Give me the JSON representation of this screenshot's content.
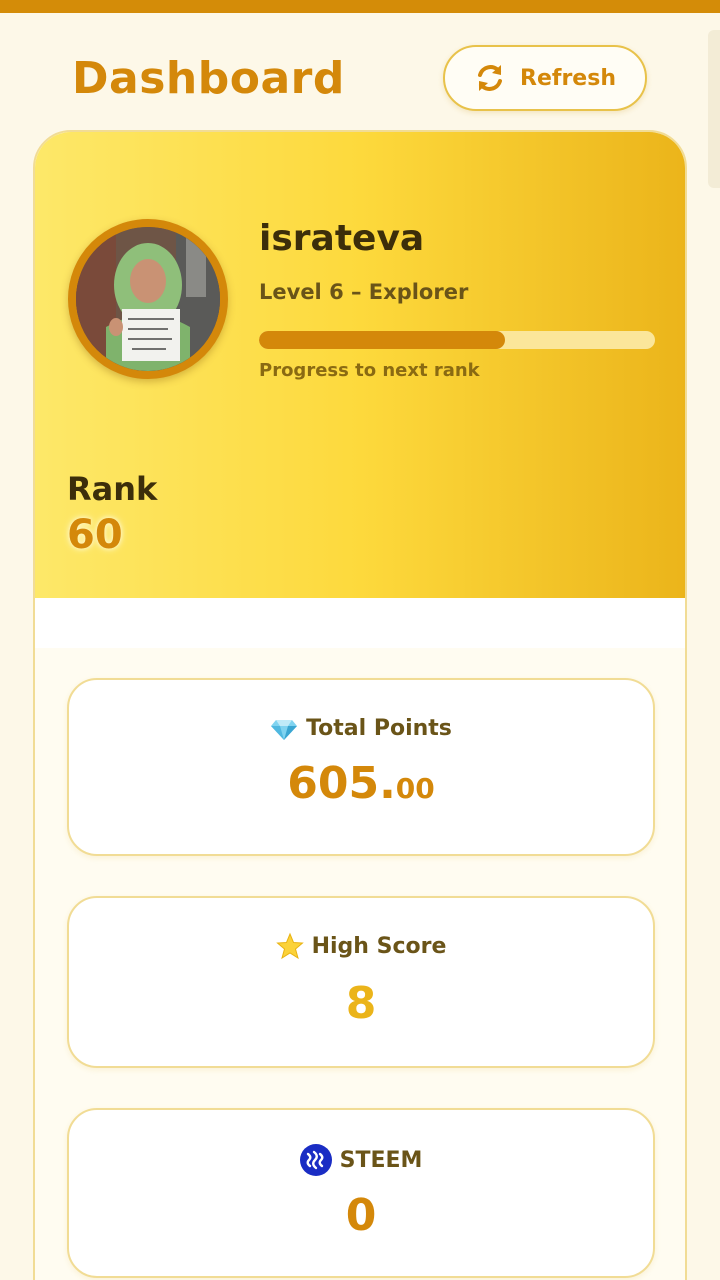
{
  "header": {
    "title": "Dashboard",
    "refresh_label": "Refresh"
  },
  "profile": {
    "username": "israteva",
    "level": "Level 6 – Explorer",
    "progress_fraction": 0.62,
    "progress_label": "Progress to next rank",
    "rank_label": "Rank",
    "rank_value": "60"
  },
  "stats": {
    "points": {
      "icon": "gem-icon",
      "label": "Total Points",
      "value_int": "605.",
      "value_dec": "00"
    },
    "high_score": {
      "icon": "star-icon",
      "label": "High Score",
      "value": "8"
    },
    "steem": {
      "icon": "steem-logo-icon",
      "label": "STEEM",
      "value": "0"
    }
  },
  "colors": {
    "accent": "#d4880a",
    "gold": "#ebb41a",
    "background": "#fdf8e8",
    "steem_blue": "#1a2dc4"
  }
}
